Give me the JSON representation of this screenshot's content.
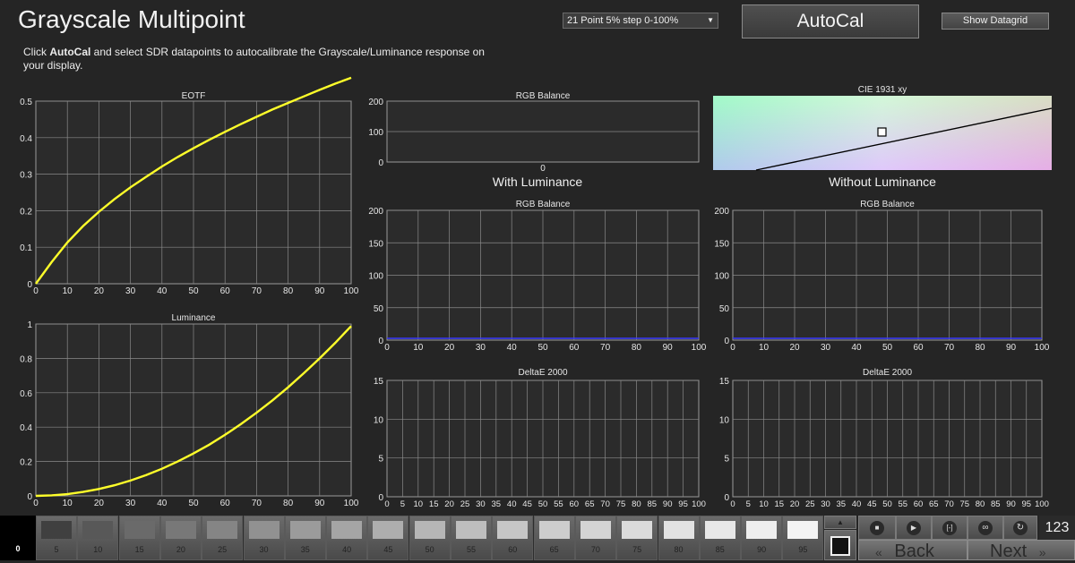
{
  "header": {
    "title": "Grayscale Multipoint",
    "desc_pre": "Click ",
    "desc_bold": "AutoCal",
    "desc_post": " and select SDR datapoints to autocalibrate the Grayscale/Luminance response on your display.",
    "select_value": "21 Point 5% step 0-100%",
    "autocal_label": "AutoCal",
    "datagrid_label": "Show Datagrid"
  },
  "sections": {
    "with_luminance": "With Luminance",
    "without_luminance": "Without Luminance"
  },
  "colors": {
    "curve": "#ffff2a",
    "series_line": "#3a3aff",
    "plot_bg": "#2b2b2b",
    "grid": "#8a8a8a"
  },
  "chart_data": [
    {
      "type": "line",
      "title": "EOTF",
      "x": [
        0,
        5,
        10,
        15,
        20,
        25,
        30,
        35,
        40,
        45,
        50,
        55,
        60,
        65,
        70,
        75,
        80,
        85,
        90,
        95,
        100
      ],
      "series": [
        {
          "values": [
            0,
            0.059,
            0.113,
            0.158,
            0.197,
            0.232,
            0.264,
            0.293,
            0.321,
            0.347,
            0.371,
            0.394,
            0.416,
            0.437,
            0.457,
            0.477,
            0.495,
            0.513,
            0.531,
            0.548,
            0.564
          ]
        }
      ],
      "xticks": [
        0,
        10,
        20,
        30,
        40,
        50,
        60,
        70,
        80,
        90,
        100
      ],
      "yticks": [
        "0",
        "0.1",
        "0.2",
        "0.3",
        "0.4",
        "0.5"
      ],
      "xlim": [
        0,
        100
      ],
      "ylim": [
        0,
        0.5
      ],
      "grid": true
    },
    {
      "type": "line",
      "title": "Luminance",
      "x": [
        0,
        5,
        10,
        15,
        20,
        25,
        30,
        35,
        40,
        45,
        50,
        55,
        60,
        65,
        70,
        75,
        80,
        85,
        90,
        95,
        100
      ],
      "series": [
        {
          "values": [
            0,
            0.003,
            0.01,
            0.023,
            0.04,
            0.062,
            0.089,
            0.121,
            0.158,
            0.2,
            0.247,
            0.298,
            0.355,
            0.417,
            0.484,
            0.555,
            0.632,
            0.714,
            0.8,
            0.891,
            0.988
          ]
        }
      ],
      "xticks": [
        0,
        10,
        20,
        30,
        40,
        50,
        60,
        70,
        80,
        90,
        100
      ],
      "yticks": [
        "0",
        "0.2",
        "0.4",
        "0.6",
        "0.8",
        "1"
      ],
      "xlim": [
        0,
        100
      ],
      "ylim": [
        0,
        1
      ],
      "grid": true
    },
    {
      "type": "bar",
      "title": "RGB Balance",
      "xticks": [
        "0"
      ],
      "yticks": [
        "0",
        "100",
        "200"
      ],
      "ylim": [
        0,
        200
      ],
      "grid": true,
      "series": []
    },
    {
      "type": "line",
      "title": "RGB Balance",
      "x": [
        0,
        100
      ],
      "series": [
        {
          "values": [
            0,
            0
          ]
        }
      ],
      "xticks": [
        0,
        10,
        20,
        30,
        40,
        50,
        60,
        70,
        80,
        90,
        100
      ],
      "yticks": [
        "0",
        "50",
        "100",
        "150",
        "200"
      ],
      "xlim": [
        0,
        100
      ],
      "ylim": [
        0,
        200
      ],
      "grid": true
    },
    {
      "type": "line",
      "title": "RGB Balance",
      "x": [
        0,
        100
      ],
      "series": [
        {
          "values": [
            0,
            0
          ]
        }
      ],
      "xticks": [
        0,
        10,
        20,
        30,
        40,
        50,
        60,
        70,
        80,
        90,
        100
      ],
      "yticks": [
        "0",
        "50",
        "100",
        "150",
        "200"
      ],
      "xlim": [
        0,
        100
      ],
      "ylim": [
        0,
        200
      ],
      "grid": true
    },
    {
      "type": "bar",
      "title": "DeltaE 2000",
      "xticks": [
        0,
        5,
        10,
        15,
        20,
        25,
        30,
        35,
        40,
        45,
        50,
        55,
        60,
        65,
        70,
        75,
        80,
        85,
        90,
        95,
        100
      ],
      "yticks": [
        "0",
        "5",
        "10",
        "15"
      ],
      "ylim": [
        0,
        15
      ],
      "grid": true,
      "series": []
    },
    {
      "type": "bar",
      "title": "DeltaE 2000",
      "xticks": [
        0,
        5,
        10,
        15,
        20,
        25,
        30,
        35,
        40,
        45,
        50,
        55,
        60,
        65,
        70,
        75,
        80,
        85,
        90,
        95,
        100
      ],
      "yticks": [
        "0",
        "5",
        "10",
        "15"
      ],
      "ylim": [
        0,
        15
      ],
      "grid": true,
      "series": []
    },
    {
      "type": "scatter",
      "title": "CIE 1931 xy",
      "series": []
    }
  ],
  "swatches": [
    {
      "label": "0",
      "level": 0
    },
    {
      "label": "5",
      "level": 5
    },
    {
      "label": "10",
      "level": 10
    },
    {
      "label": "15",
      "level": 15
    },
    {
      "label": "20",
      "level": 20
    },
    {
      "label": "25",
      "level": 25
    },
    {
      "label": "30",
      "level": 30
    },
    {
      "label": "35",
      "level": 35
    },
    {
      "label": "40",
      "level": 40
    },
    {
      "label": "45",
      "level": 45
    },
    {
      "label": "50",
      "level": 50
    },
    {
      "label": "55",
      "level": 55
    },
    {
      "label": "60",
      "level": 60
    },
    {
      "label": "65",
      "level": 65
    },
    {
      "label": "70",
      "level": 70
    },
    {
      "label": "75",
      "level": 75
    },
    {
      "label": "80",
      "level": 80
    },
    {
      "label": "85",
      "level": 85
    },
    {
      "label": "90",
      "level": 90
    },
    {
      "label": "95",
      "level": 95
    }
  ],
  "controls": {
    "stop_icon": "stop-icon",
    "play_icon": "play-icon",
    "bracket_icon": "read-series-icon",
    "loop_icon": "continuous-icon",
    "refresh_icon": "refresh-icon",
    "counter": "123",
    "back_label": "Back",
    "next_label": "Next"
  }
}
